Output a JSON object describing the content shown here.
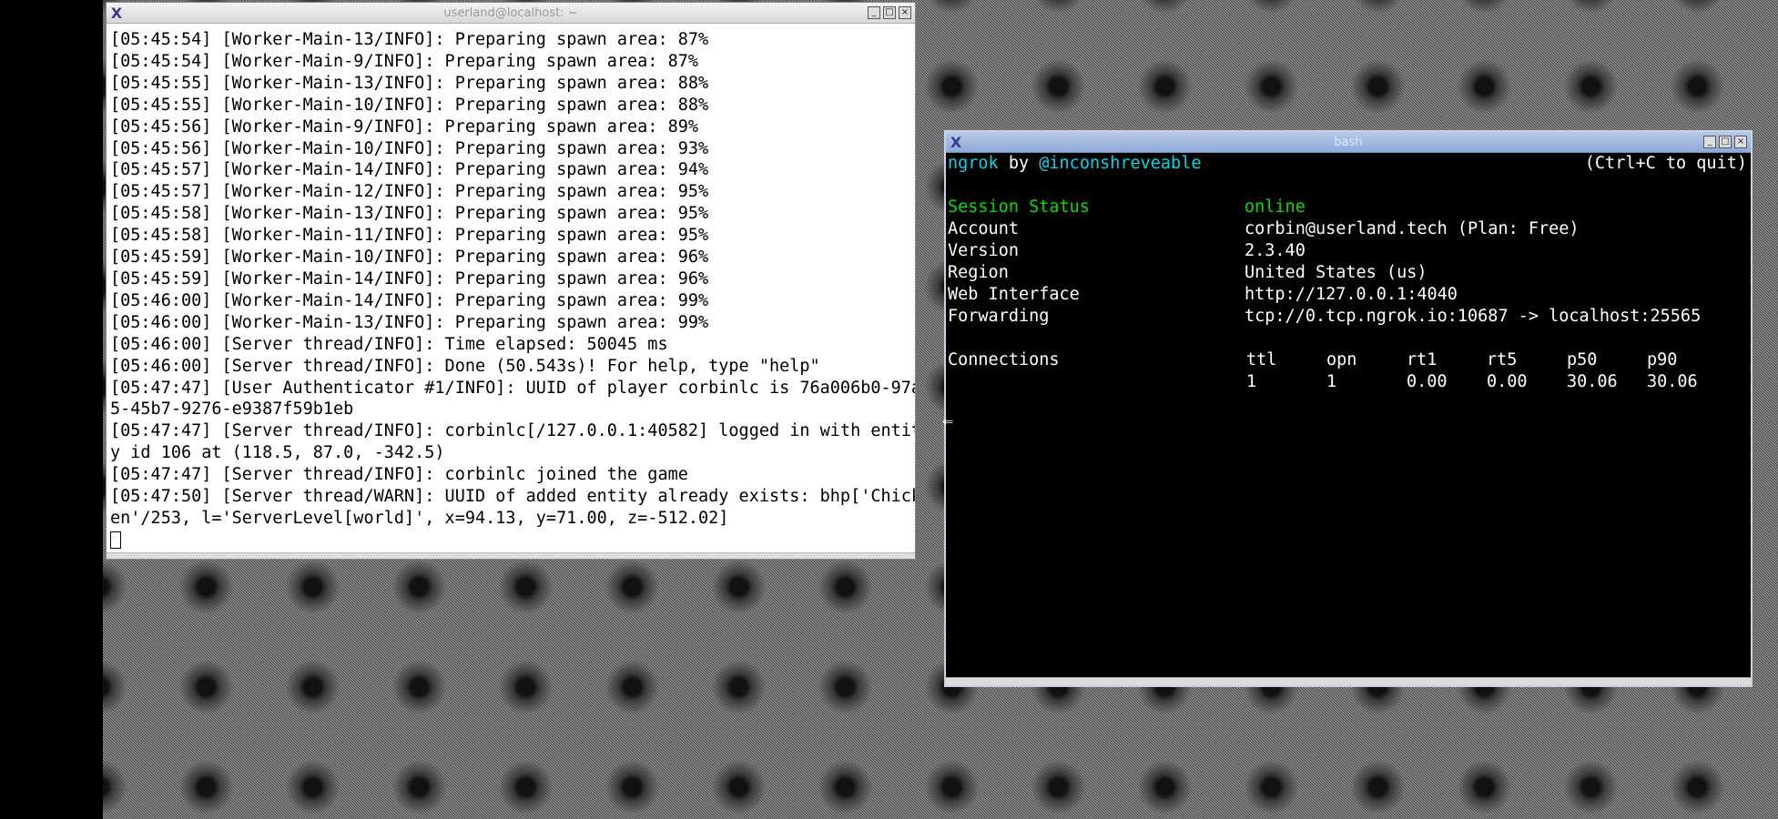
{
  "left_window": {
    "title": "userland@localhost: ~",
    "lines": [
      "[05:45:54] [Worker-Main-13/INFO]: Preparing spawn area: 87%",
      "[05:45:54] [Worker-Main-9/INFO]: Preparing spawn area: 87%",
      "[05:45:55] [Worker-Main-13/INFO]: Preparing spawn area: 88%",
      "[05:45:55] [Worker-Main-10/INFO]: Preparing spawn area: 88%",
      "[05:45:56] [Worker-Main-9/INFO]: Preparing spawn area: 89%",
      "[05:45:56] [Worker-Main-10/INFO]: Preparing spawn area: 93%",
      "[05:45:57] [Worker-Main-14/INFO]: Preparing spawn area: 94%",
      "[05:45:57] [Worker-Main-12/INFO]: Preparing spawn area: 95%",
      "[05:45:58] [Worker-Main-13/INFO]: Preparing spawn area: 95%",
      "[05:45:58] [Worker-Main-11/INFO]: Preparing spawn area: 95%",
      "[05:45:59] [Worker-Main-10/INFO]: Preparing spawn area: 96%",
      "[05:45:59] [Worker-Main-14/INFO]: Preparing spawn area: 96%",
      "[05:46:00] [Worker-Main-14/INFO]: Preparing spawn area: 99%",
      "[05:46:00] [Worker-Main-13/INFO]: Preparing spawn area: 99%",
      "[05:46:00] [Server thread/INFO]: Time elapsed: 50045 ms",
      "[05:46:00] [Server thread/INFO]: Done (50.543s)! For help, type \"help\"",
      "[05:47:47] [User Authenticator #1/INFO]: UUID of player corbinlc is 76a006b0-97a",
      "5-45b7-9276-e9387f59b1eb",
      "[05:47:47] [Server thread/INFO]: corbinlc[/127.0.0.1:40582] logged in with entit",
      "y id 106 at (118.5, 87.0, -342.5)",
      "[05:47:47] [Server thread/INFO]: corbinlc joined the game",
      "[05:47:50] [Server thread/WARN]: UUID of added entity already exists: bhp['Chick",
      "en'/253, l='ServerLevel[world]', x=94.13, y=71.00, z=-512.02]"
    ]
  },
  "right_window": {
    "title": "bash",
    "header_left": "ngrok",
    "header_by": " by ",
    "header_handle": "@inconshreveable",
    "header_right": "(Ctrl+C to quit)",
    "session_label": "Session Status",
    "session_value": "online",
    "rows": [
      {
        "label": "Account",
        "value": "corbin@userland.tech (Plan: Free)"
      },
      {
        "label": "Version",
        "value": "2.3.40"
      },
      {
        "label": "Region",
        "value": "United States (us)"
      },
      {
        "label": "Web Interface",
        "value": "http://127.0.0.1:4040"
      },
      {
        "label": "Forwarding",
        "value": "tcp://0.tcp.ngrok.io:10687 -> localhost:25565"
      }
    ],
    "connections_label": "Connections",
    "conn_headers": [
      "ttl",
      "opn",
      "rt1",
      "rt5",
      "p50",
      "p90"
    ],
    "conn_values": [
      "1",
      "1",
      "0.00",
      "0.00",
      "30.06",
      "30.06"
    ],
    "prompt_glyph": "⇐"
  }
}
